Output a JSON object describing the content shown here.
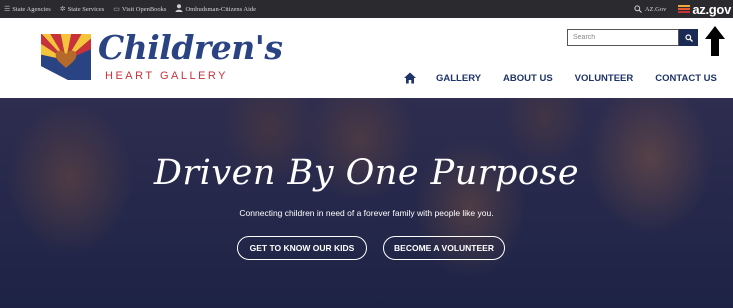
{
  "topbar": {
    "links": [
      {
        "label": "State Agencies",
        "icon": "list-icon"
      },
      {
        "label": "State Services",
        "icon": "gear-icon"
      },
      {
        "label": "Visit OpenBooks",
        "icon": "book-icon"
      },
      {
        "label": "Ombudsman-Citizens Aide",
        "icon": "person-icon"
      }
    ],
    "azgov_link": "AZ.Gov",
    "azgov_logo": "az.gov"
  },
  "header": {
    "logo_word": "Children's",
    "logo_sub": "HEART GALLERY",
    "search_placeholder": "Search",
    "nav": [
      "GALLERY",
      "ABOUT US",
      "VOLUNTEER",
      "CONTACT US"
    ]
  },
  "hero": {
    "title": "Driven By One Purpose",
    "subtitle": "Connecting children in need of a forever family with people like you.",
    "button_kids": "GET TO KNOW OUR KIDS",
    "button_volunteer": "BECOME A VOLUNTEER"
  },
  "colors": {
    "brand_blue": "#2a4383",
    "brand_red": "#c8323a",
    "nav_blue": "#1f3468",
    "topbar": "#2b2b2f"
  }
}
